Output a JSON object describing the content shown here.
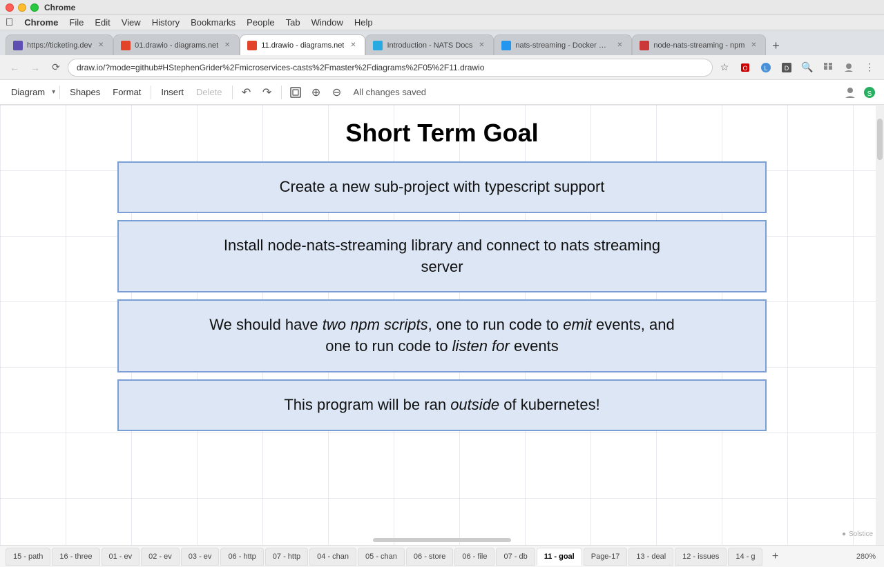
{
  "os": {
    "apple_label": ""
  },
  "chrome_menu": {
    "items": [
      "Chrome",
      "File",
      "Edit",
      "View",
      "History",
      "Bookmarks",
      "People",
      "Tab",
      "Window",
      "Help"
    ]
  },
  "tabs": [
    {
      "id": "tab-ticket",
      "title": "https://ticketing.dev",
      "favicon_type": "ticket",
      "active": false
    },
    {
      "id": "tab-drawio1",
      "title": "01.drawio - diagrams.net",
      "favicon_type": "drawio",
      "active": false
    },
    {
      "id": "tab-drawio11",
      "title": "11.drawio - diagrams.net",
      "favicon_type": "drawio",
      "active": true
    },
    {
      "id": "tab-nats-docs",
      "title": "Introduction - NATS Docs",
      "favicon_type": "nats",
      "active": false
    },
    {
      "id": "tab-docker",
      "title": "nats-streaming - Docker Hub",
      "favicon_type": "docker",
      "active": false
    },
    {
      "id": "tab-npm",
      "title": "node-nats-streaming - npm",
      "favicon_type": "npm",
      "active": false
    }
  ],
  "address_bar": {
    "url": "draw.io/?mode=github#HStephenGrider%2Fmicroservices-casts%2Fmaster%2Fdiagrams%2F05%2F11.drawio"
  },
  "toolbar": {
    "diagram_label": "Diagram",
    "shapes_label": "Shapes",
    "format_label": "Format",
    "insert_label": "Insert",
    "delete_label": "Delete",
    "status_label": "All changes saved"
  },
  "diagram": {
    "title": "Short Term Goal",
    "boxes": [
      {
        "id": "box1",
        "text_html": "Create a new sub-project with typescript support"
      },
      {
        "id": "box2",
        "text_html": "Install node-nats-streaming library and connect to nats streaming server"
      },
      {
        "id": "box3",
        "text_html": "We should have <i>two npm scripts</i>, one to run code to <i>emit</i> events, and one to run code to <i>listen for</i> events"
      },
      {
        "id": "box4",
        "text_html": "This program will be ran <i>outside</i> of kubernetes!"
      }
    ]
  },
  "page_tabs": [
    {
      "id": "15-path",
      "label": "15 - path",
      "active": false
    },
    {
      "id": "16-three",
      "label": "16 - three",
      "active": false
    },
    {
      "id": "01-ev",
      "label": "01 - ev",
      "active": false
    },
    {
      "id": "02-ev",
      "label": "02 - ev",
      "active": false
    },
    {
      "id": "03-ev",
      "label": "03 - ev",
      "active": false
    },
    {
      "id": "06-http",
      "label": "06 - http",
      "active": false
    },
    {
      "id": "07-http",
      "label": "07 - http",
      "active": false
    },
    {
      "id": "04-chan",
      "label": "04 - chan",
      "active": false
    },
    {
      "id": "05-chan",
      "label": "05 - chan",
      "active": false
    },
    {
      "id": "06-store",
      "label": "06 - store",
      "active": false
    },
    {
      "id": "06-file",
      "label": "06 - file",
      "active": false
    },
    {
      "id": "07-db",
      "label": "07 - db",
      "active": false
    },
    {
      "id": "11-goal",
      "label": "11 - goal",
      "active": true
    },
    {
      "id": "Page-17",
      "label": "Page-17",
      "active": false
    },
    {
      "id": "13-deal",
      "label": "13 - deal",
      "active": false
    },
    {
      "id": "12-issues",
      "label": "12 - issues",
      "active": false
    },
    {
      "id": "14-g",
      "label": "14 - g",
      "active": false
    }
  ],
  "zoom_label": "280%"
}
